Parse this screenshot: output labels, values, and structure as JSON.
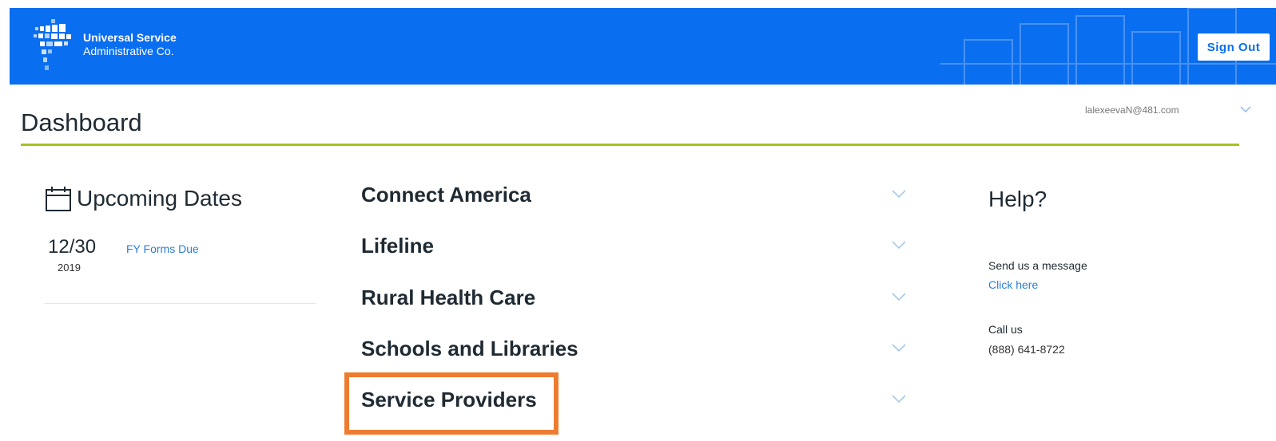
{
  "header": {
    "org_line1": "Universal Service",
    "org_line2": "Administrative Co.",
    "signout_label": "Sign Out"
  },
  "page": {
    "title": "Dashboard",
    "user_email": "lalexeevaN@481.com"
  },
  "upcoming": {
    "heading": "Upcoming Dates",
    "items": [
      {
        "date": "12/30",
        "year": "2019",
        "label": "FY Forms Due"
      }
    ]
  },
  "programs": [
    {
      "label": "Connect America"
    },
    {
      "label": "Lifeline"
    },
    {
      "label": "Rural Health Care"
    },
    {
      "label": "Schools and Libraries"
    },
    {
      "label": "Service Providers",
      "highlighted": true
    }
  ],
  "help": {
    "title": "Help?",
    "message_label": "Send us a message",
    "message_link": "Click here",
    "call_label": "Call us",
    "phone": "(888) 641-8722"
  },
  "colors": {
    "header_blue": "#0a6ef0",
    "accent_green": "#a8c220",
    "highlight_orange": "#ee7c30",
    "link_blue": "#2a7fd6"
  },
  "icons": [
    "usac-logo-icon",
    "calendar-icon",
    "chevron-down-icon"
  ]
}
